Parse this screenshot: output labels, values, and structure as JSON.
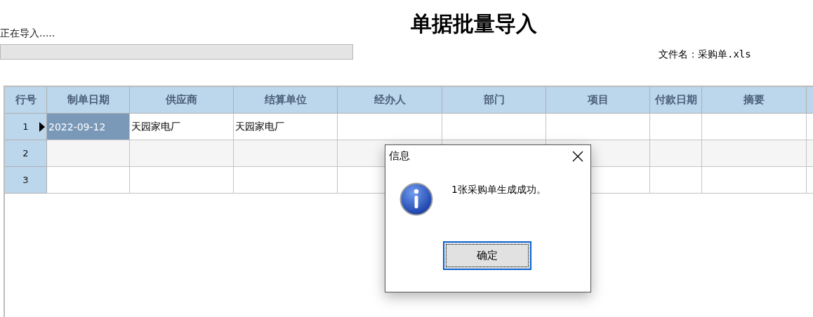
{
  "title": "单据批量导入",
  "status": "正在导入.....",
  "file_label": "文件名：采购单.xls",
  "table": {
    "row_header": "行号",
    "columns": [
      "制单日期",
      "供应商",
      "结算单位",
      "经办人",
      "部门",
      "项目",
      "付款日期",
      "摘要"
    ],
    "rows": [
      {
        "number": "1",
        "current": true,
        "cells": [
          {
            "text": "2022-09-12",
            "selected": true
          },
          {
            "text": "天园家电厂",
            "selected": false
          },
          {
            "text": "天园家电厂",
            "selected": false
          }
        ]
      },
      {
        "number": "2",
        "current": false
      },
      {
        "number": "3",
        "current": false
      }
    ]
  },
  "dialog": {
    "title": "信息",
    "message": "1张采购单生成成功。",
    "button": "确定"
  }
}
